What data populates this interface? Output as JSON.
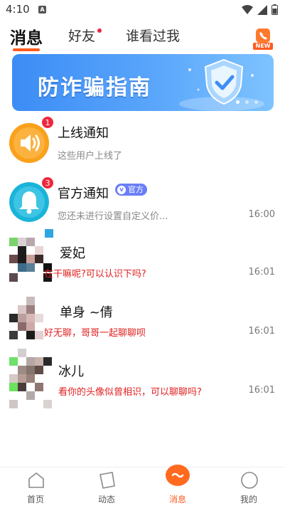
{
  "status_bar": {
    "time": "4:10",
    "notif_letter": "A"
  },
  "top_tabs": [
    {
      "label": "消息",
      "active": true
    },
    {
      "label": "好友",
      "has_dot": true
    },
    {
      "label": "谁看过我"
    }
  ],
  "call_button": {
    "badge": "NEW",
    "icon": "phone-icon"
  },
  "banner": {
    "title": "防诈骗指南",
    "icon": "shield-check-icon",
    "pages": 3,
    "current_page": 1
  },
  "messages": [
    {
      "name": "上线通知",
      "preview": "这些用户上线了",
      "time": "",
      "badge": "1",
      "avatar": "speaker-icon"
    },
    {
      "name": "官方通知",
      "tag": "官方",
      "preview": "您还未进行设置自定义价...",
      "time": "16:00",
      "badge": "3",
      "avatar": "bell-icon"
    },
    {
      "name": "爱妃",
      "preview": "在干嘛呢?可以认识下吗?",
      "time": "16:01"
    },
    {
      "name": "单身 ~倩",
      "preview": "好无聊，哥哥一起聊聊呗",
      "time": "16:01"
    },
    {
      "name": "冰儿",
      "preview": "看你的头像似曾相识，可以聊聊吗?",
      "time": "16:01"
    }
  ],
  "bottom_nav": [
    {
      "label": "首页",
      "icon": "home-icon"
    },
    {
      "label": "动态",
      "icon": "feed-icon"
    },
    {
      "label": "消息",
      "icon": "message-icon",
      "active": true
    },
    {
      "label": "我的",
      "icon": "profile-icon"
    }
  ],
  "colors": {
    "accent": "#ff5a1f",
    "badge": "#f0263c",
    "preview_red": "#e02020",
    "official_tag": "#6a7ef7"
  }
}
